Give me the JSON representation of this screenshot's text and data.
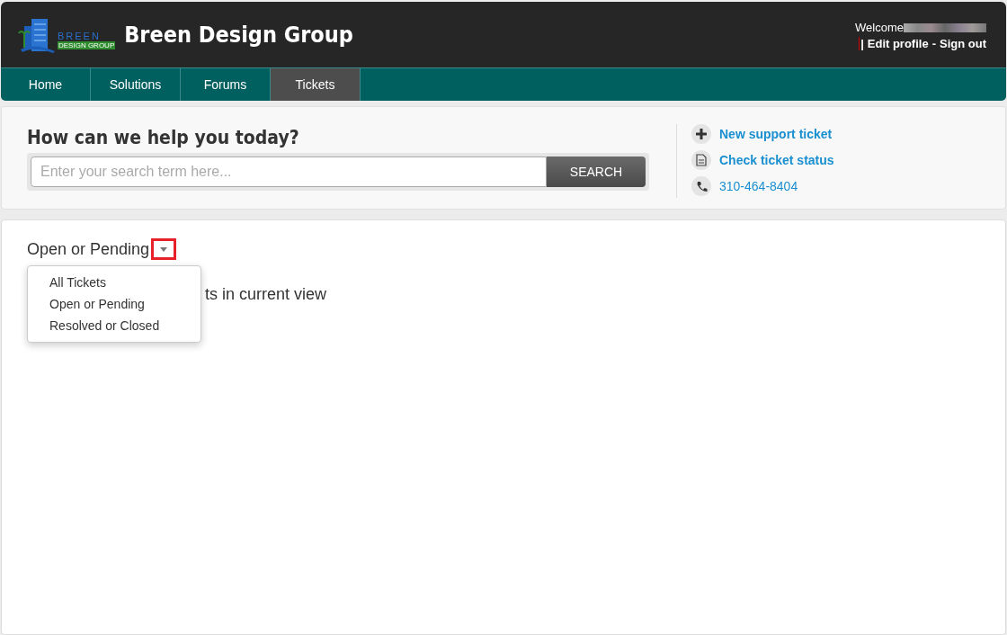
{
  "header": {
    "logo_text": "BREEN",
    "logo_subtext": "DESIGN GROUP",
    "title": "Breen Design Group",
    "welcome": "Welcome",
    "separator": "|",
    "edit_profile": "Edit profile",
    "dash": "-",
    "sign_out": "Sign out"
  },
  "tabs": [
    {
      "label": "Home",
      "selected": false
    },
    {
      "label": "Solutions",
      "selected": false
    },
    {
      "label": "Forums",
      "selected": false
    },
    {
      "label": "Tickets",
      "selected": true
    }
  ],
  "search": {
    "heading": "How can we help you today?",
    "placeholder": "Enter your search term here...",
    "button": "SEARCH"
  },
  "quick_links": [
    {
      "kind": "plus",
      "label": "New support ticket"
    },
    {
      "kind": "document",
      "label": "Check ticket status"
    },
    {
      "kind": "phone",
      "label": "310-464-8404"
    }
  ],
  "view_filter": {
    "label": "Open or Pending",
    "expanded": true,
    "options": [
      {
        "label": "All Tickets"
      },
      {
        "label": "Open or Pending"
      },
      {
        "label": "Resolved or Closed"
      }
    ]
  },
  "status_text": "ts in current view"
}
